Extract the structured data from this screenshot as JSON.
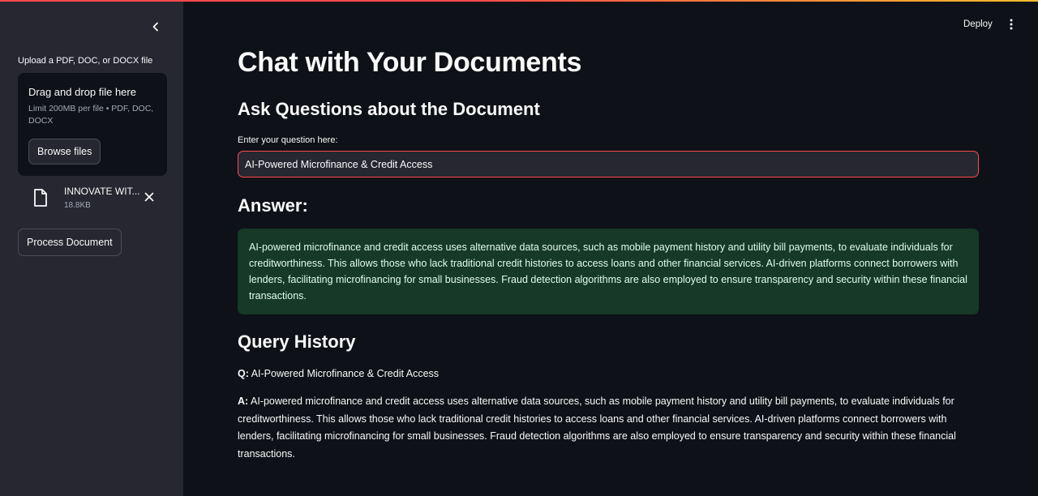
{
  "sidebar": {
    "upload_label": "Upload a PDF, DOC, or DOCX file",
    "dropzone": {
      "title": "Drag and drop file here",
      "limit": "Limit 200MB per file • PDF, DOC, DOCX",
      "browse_label": "Browse files"
    },
    "file": {
      "name": "INNOVATE WIT...",
      "size": "18.8KB"
    },
    "process_label": "Process Document"
  },
  "header": {
    "deploy_label": "Deploy"
  },
  "main": {
    "title": "Chat with Your Documents",
    "ask_heading": "Ask Questions about the Document",
    "question_label": "Enter your question here:",
    "question_value": "AI-Powered Microfinance & Credit Access",
    "answer_heading": "Answer:",
    "answer_text": "AI-powered microfinance and credit access uses alternative data sources, such as mobile payment history and utility bill payments, to evaluate individuals for creditworthiness. This allows those who lack traditional credit histories to access loans and other financial services. AI-driven platforms connect borrowers with lenders, facilitating microfinancing for small businesses. Fraud detection algorithms are also employed to ensure transparency and security within these financial transactions.",
    "history_heading": "Query History",
    "history": [
      {
        "q_prefix": "Q:",
        "question": "AI-Powered Microfinance & Credit Access",
        "a_prefix": "A:",
        "answer": "AI-powered microfinance and credit access uses alternative data sources, such as mobile payment history and utility bill payments, to evaluate individuals for creditworthiness. This allows those who lack traditional credit histories to access loans and other financial services. AI-driven platforms connect borrowers with lenders, facilitating microfinancing for small businesses. Fraud detection algorithms are also employed to ensure transparency and security within these financial transactions."
      }
    ]
  },
  "icons": {
    "collapse": "chevron-left-icon",
    "file": "document-icon",
    "remove": "close-icon",
    "menu": "vertical-dots-icon"
  },
  "colors": {
    "background": "#0e1117",
    "sidebar": "#262730",
    "accent": "#ff4b4b",
    "success_bg": "#173928",
    "success_text": "#dffde9"
  }
}
